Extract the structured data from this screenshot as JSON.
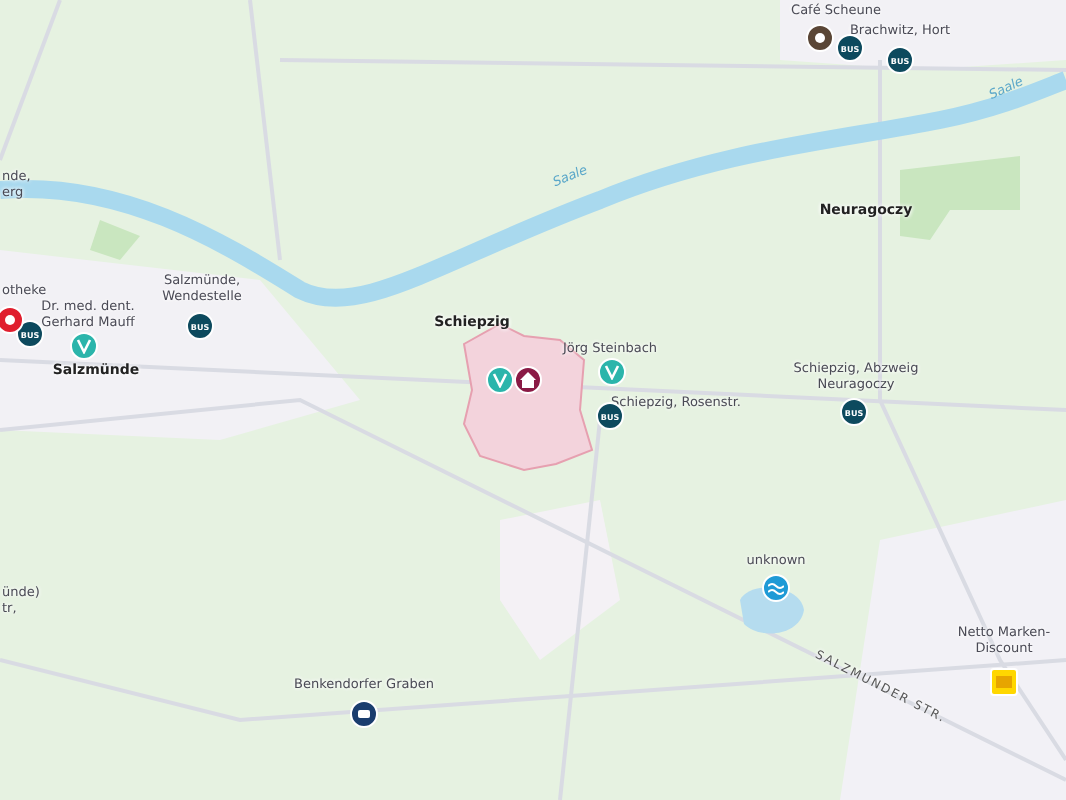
{
  "labels": [
    {
      "kind": "poi",
      "lines": [
        "Café Scheune"
      ]
    },
    {
      "kind": "poi",
      "lines": [
        "Brachwitz, Hort"
      ]
    },
    {
      "kind": "water",
      "lines": [
        "Saale"
      ]
    },
    {
      "kind": "water",
      "lines": [
        "Saale"
      ]
    },
    {
      "kind": "poi",
      "lines": [
        "nde,",
        "erg"
      ]
    },
    {
      "kind": "town",
      "lines": [
        "Neuragoczy"
      ]
    },
    {
      "kind": "poi",
      "lines": [
        "otheke"
      ]
    },
    {
      "kind": "poi",
      "lines": [
        "Salzmünde,",
        "Wendestelle"
      ]
    },
    {
      "kind": "poi",
      "lines": [
        "Dr. med. dent.",
        "Gerhard Mauff"
      ]
    },
    {
      "kind": "town",
      "lines": [
        "Schiepzig"
      ]
    },
    {
      "kind": "poi",
      "lines": [
        "Jörg Steinbach"
      ]
    },
    {
      "kind": "town",
      "lines": [
        "Salzmünde"
      ]
    },
    {
      "kind": "poi",
      "lines": [
        "Schiepzig, Abzweig",
        "Neuragoczy"
      ]
    },
    {
      "kind": "poi",
      "lines": [
        "Schiepzig, Rosenstr."
      ]
    },
    {
      "kind": "poi",
      "lines": [
        "unknown"
      ]
    },
    {
      "kind": "poi",
      "lines": [
        "ünde)",
        "tr,"
      ]
    },
    {
      "kind": "poi",
      "lines": [
        "Netto Marken-",
        "Discount"
      ]
    },
    {
      "kind": "street",
      "lines": [
        "SALZMUNDER STR."
      ]
    },
    {
      "kind": "poi",
      "lines": [
        "Benkendorfer Graben"
      ]
    }
  ],
  "pins": [
    {
      "kind": "cafe"
    },
    {
      "kind": "bus",
      "label": "BUS"
    },
    {
      "kind": "bus",
      "label": "BUS"
    },
    {
      "kind": "bus",
      "label": "BUS"
    },
    {
      "kind": "bus",
      "label": "BUS"
    },
    {
      "kind": "bus",
      "label": "BUS"
    },
    {
      "kind": "bus",
      "label": "BUS"
    },
    {
      "kind": "health"
    },
    {
      "kind": "health"
    },
    {
      "kind": "home"
    },
    {
      "kind": "health"
    },
    {
      "kind": "pharmacy"
    },
    {
      "kind": "water"
    },
    {
      "kind": "shop"
    },
    {
      "kind": "parking"
    }
  ]
}
